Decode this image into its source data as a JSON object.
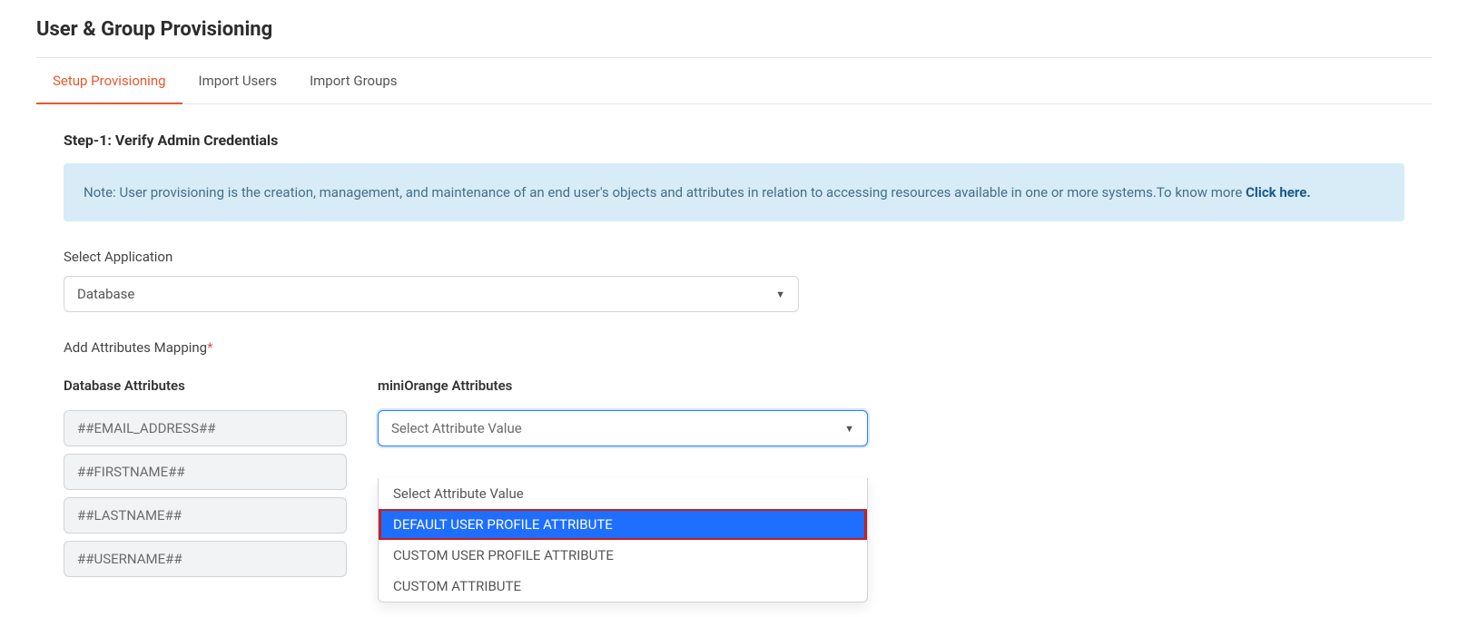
{
  "header": {
    "title": "User & Group Provisioning"
  },
  "tabs": [
    {
      "label": "Setup Provisioning",
      "active": true
    },
    {
      "label": "Import Users",
      "active": false
    },
    {
      "label": "Import Groups",
      "active": false
    }
  ],
  "step": {
    "heading": "Step-1: Verify Admin Credentials"
  },
  "info": {
    "text": "Note: User provisioning is the creation, management, and maintenance of an end user's objects and attributes in relation to accessing resources available in one or more systems.To know more ",
    "link": "Click here."
  },
  "select_app": {
    "label": "Select Application",
    "value": "Database"
  },
  "mapping": {
    "label": "Add Attributes Mapping",
    "left_heading": "Database Attributes",
    "right_heading": "miniOrange Attributes",
    "db_attrs": [
      "##EMAIL_ADDRESS##",
      "##FIRSTNAME##",
      "##LASTNAME##",
      "##USERNAME##"
    ],
    "mo_placeholder": "Select Attribute Value",
    "dropdown_options": [
      {
        "label": "Select Attribute Value",
        "highlight": false
      },
      {
        "label": "DEFAULT USER PROFILE ATTRIBUTE",
        "highlight": true
      },
      {
        "label": "CUSTOM USER PROFILE ATTRIBUTE",
        "highlight": false
      },
      {
        "label": "CUSTOM ATTRIBUTE",
        "highlight": false
      }
    ]
  }
}
